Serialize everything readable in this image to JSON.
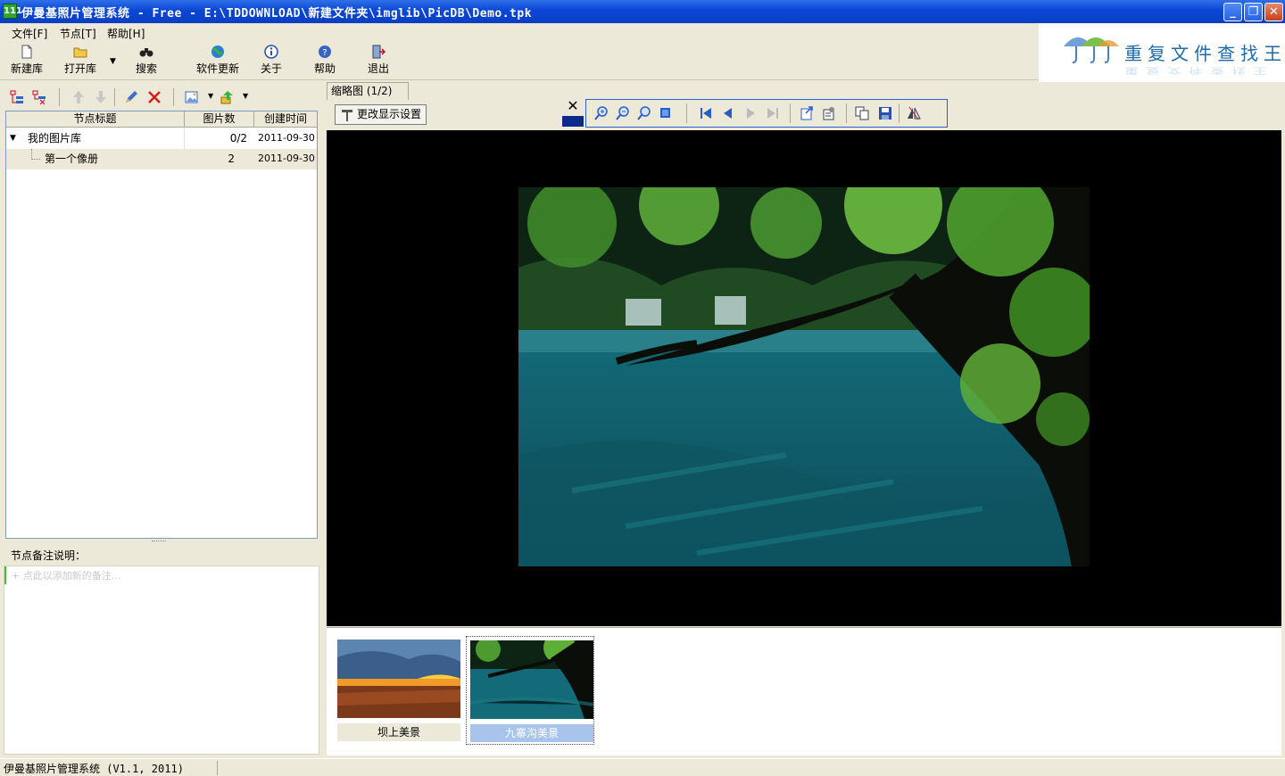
{
  "window": {
    "title": "伊曼基照片管理系统 - Free - E:\\TDDOWNLOAD\\新建文件夹\\imglib\\PicDB\\Demo.tpk",
    "icon_glyph": "111",
    "minimize": "_",
    "maximize": "❐",
    "close": "✕"
  },
  "menu": [
    "文件[F]",
    "节点[T]",
    "帮助[H]"
  ],
  "toolbar": {
    "new": "新建库",
    "open": "打开库",
    "search": "搜索",
    "update": "软件更新",
    "about": "关于",
    "help": "帮助",
    "exit": "退出"
  },
  "logo": {
    "text": "重复文件查找王",
    "reflection": "重复文件查找王"
  },
  "tree": {
    "columns": [
      "节点标题",
      "图片数",
      "创建时间"
    ],
    "rows": [
      {
        "title": "我的图片库",
        "count": "0/2",
        "date": "2011-09-30"
      },
      {
        "title": "第一个像册",
        "count": "2",
        "date": "2011-09-30"
      }
    ]
  },
  "notes": {
    "label": "节点备注说明：",
    "placeholder": "+ 点此以添加新的备注..."
  },
  "viewer": {
    "tab": "缩略图 (1/2)",
    "settings_button": "更改显示设置",
    "close_glyph": "✕"
  },
  "thumbnails": [
    {
      "caption": "坝上美景",
      "selected": false
    },
    {
      "caption": "九寨沟美景",
      "selected": true
    }
  ],
  "status": {
    "text": "伊曼基照片管理系统 (V1.1, 2011)"
  },
  "colors": {
    "titlebar": "#0a46d6",
    "selection": "#a8c4ea",
    "viewer_bg": "#000000"
  }
}
